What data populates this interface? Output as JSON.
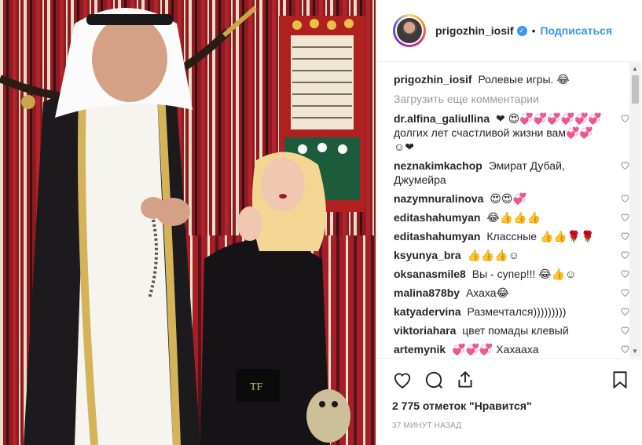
{
  "header": {
    "username": "prigozhin_iosif",
    "follow_label": "Подписаться",
    "separator": "•"
  },
  "caption": {
    "username": "prigozhin_iosif",
    "text": "Ролевые игры. 😂"
  },
  "load_more_label": "Загрузить еще комментарии",
  "comments": [
    {
      "username": "dr.alfina_galiullina",
      "text": "❤ 😍💞💞💞💞💞💞 долгих лет счастливой жизни вам💞💞 ☺❤"
    },
    {
      "username": "neznakimkachop",
      "text": "Эмират Дубай, Джумейра"
    },
    {
      "username": "nazymnuralinova",
      "text": "😍😍💞"
    },
    {
      "username": "editashahumyan",
      "text": "😂👍👍👍"
    },
    {
      "username": "editashahumyan",
      "text": "Классные 👍👍🌹🌹"
    },
    {
      "username": "ksyunya_bra",
      "text": "👍👍👍☺"
    },
    {
      "username": "oksanasmile8",
      "text": "Вы - супер!!! 😂👍☺"
    },
    {
      "username": "malina878by",
      "text": "Ахаха😂"
    },
    {
      "username": "katyadervina",
      "text": "Размечтался)))))))))"
    },
    {
      "username": "viktoriahara",
      "text": "цвет помады клевый"
    },
    {
      "username": "artemynik",
      "text": "💞💞💞 Хахаахa"
    }
  ],
  "likes_text": "2 775 отметок \"Нравится\"",
  "time_text": "37 минут назад",
  "icons": [
    "heart-icon",
    "comment-icon",
    "share-icon",
    "bookmark-icon",
    "verified-badge-icon"
  ],
  "colors": {
    "accent": "#3897f0",
    "muted": "#999999",
    "border": "#efefef"
  }
}
